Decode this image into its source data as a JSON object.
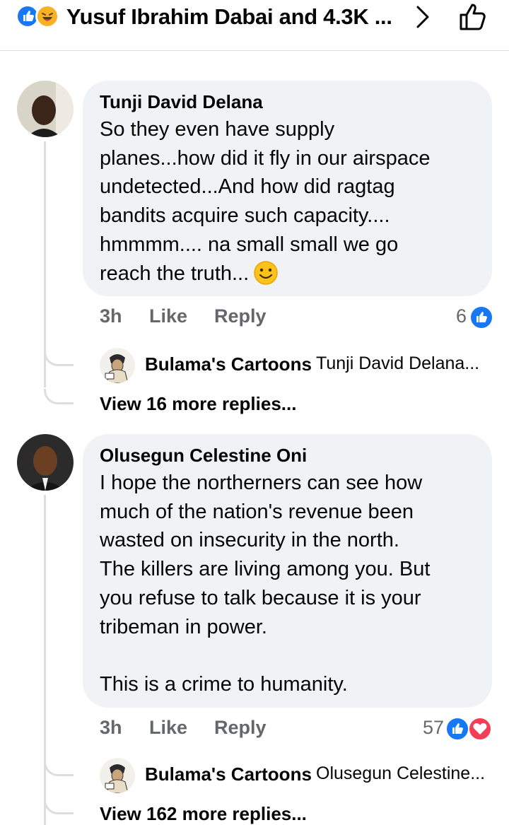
{
  "header": {
    "title": "Yusuf Ibrahim Dabai and 4.3K ...",
    "reaction_icons": [
      "like-icon",
      "haha-icon"
    ]
  },
  "comments": [
    {
      "author": "Tunji David Delana",
      "text": "So they even have supply\nplanes...how did it fly in our airspace\nundetected...And how did ragtag\nbandits acquire such capacity....\nhmmmm.... na small small we go\nreach the truth...",
      "emoji": "smile-emoji",
      "time": "3h",
      "like_label": "Like",
      "reply_label": "Reply",
      "reaction_count": "6",
      "reply_preview": {
        "author": "Bulama's Cartoons",
        "snippet": "Tunji David Delana..."
      },
      "view_more": "View 16 more replies..."
    },
    {
      "author": "Olusegun Celestine Oni",
      "text": "I hope the northerners can see how\nmuch of the nation's revenue been\nwasted on insecurity in the north.\nThe killers are living among you. But\nyou refuse to talk because it is your\ntribeman in power.\n\nThis is a crime to humanity.",
      "time": "3h",
      "like_label": "Like",
      "reply_label": "Reply",
      "reaction_count": "57",
      "reply_preview": {
        "author": "Bulama's Cartoons",
        "snippet": "Olusegun Celestine..."
      },
      "view_more": "View 162 more replies..."
    }
  ],
  "colors": {
    "like_blue": "#1877f2",
    "love_red": "#f33e58",
    "bubble_bg": "#f0f2f5",
    "muted_text": "#65676b"
  }
}
